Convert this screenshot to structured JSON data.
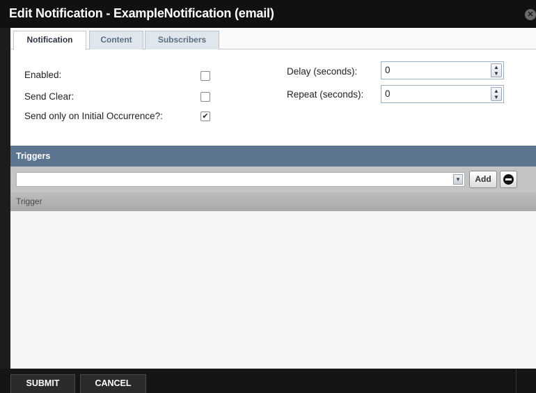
{
  "dialog": {
    "title": "Edit Notification - ExampleNotification (email)"
  },
  "tabs": [
    {
      "label": "Notification",
      "active": true
    },
    {
      "label": "Content",
      "active": false
    },
    {
      "label": "Subscribers",
      "active": false
    }
  ],
  "form": {
    "enabled": {
      "label": "Enabled:",
      "checked": false
    },
    "send_clear": {
      "label": "Send Clear:",
      "checked": false
    },
    "send_initial": {
      "label": "Send only on Initial Occurrence?:",
      "checked": true
    },
    "delay": {
      "label": "Delay (seconds):",
      "value": "0"
    },
    "repeat": {
      "label": "Repeat (seconds):",
      "value": "0"
    }
  },
  "triggers": {
    "header": "Triggers",
    "select_value": "",
    "add_label": "Add",
    "column_header": "Trigger"
  },
  "footer": {
    "submit_label": "SUBMIT",
    "cancel_label": "CANCEL"
  },
  "icons": {
    "close": "close-icon",
    "remove": "remove-icon",
    "check": "checkmark-icon",
    "spin_up": "chevron-up-icon",
    "spin_down": "chevron-down-icon"
  },
  "colors": {
    "titlebar": "#111111",
    "triggers_header": "#5c7691",
    "tab_active_text": "#2a3440",
    "tab_inactive_text": "#5a6f84"
  }
}
